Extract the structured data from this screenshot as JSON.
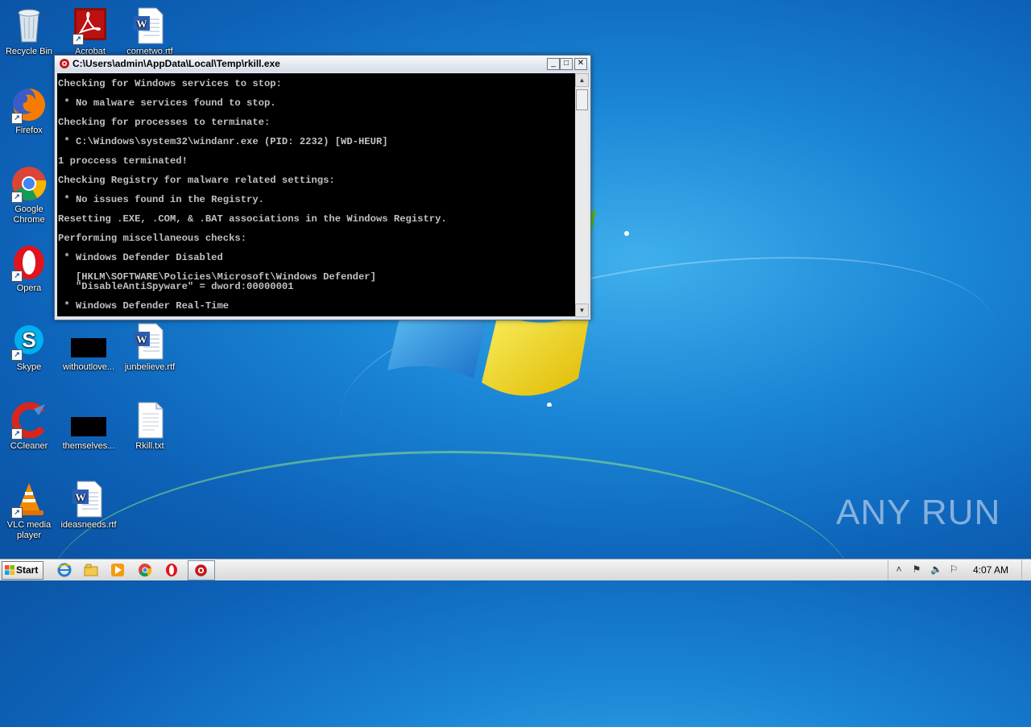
{
  "desktop": {
    "icons": [
      {
        "label": "Recycle Bin",
        "icon": "recycle-bin-icon"
      },
      {
        "label": "Acrobat",
        "icon": "acrobat-icon"
      },
      {
        "label": "cornetwo.rtf",
        "icon": "word-document-icon"
      },
      {
        "label": "Firefox",
        "icon": "firefox-icon"
      },
      {
        "label": "Google Chrome",
        "icon": "chrome-icon"
      },
      {
        "label": "Opera",
        "icon": "opera-icon"
      },
      {
        "label": "Skype",
        "icon": "skype-icon"
      },
      {
        "label": "withoutlove...",
        "icon": "black-thumbnail-icon"
      },
      {
        "label": "junbelieve.rtf",
        "icon": "word-document-icon"
      },
      {
        "label": "CCleaner",
        "icon": "ccleaner-icon"
      },
      {
        "label": "themselves...",
        "icon": "black-thumbnail-icon"
      },
      {
        "label": "Rkill.txt",
        "icon": "text-file-icon"
      },
      {
        "label": "VLC media player",
        "icon": "vlc-icon"
      },
      {
        "label": "ideasneeds.rtf",
        "icon": "word-document-icon"
      }
    ]
  },
  "window": {
    "title": "C:\\Users\\admin\\AppData\\Local\\Temp\\rkill.exe",
    "minimize": "_",
    "maximize": "□",
    "close": "✕"
  },
  "console": {
    "lines": [
      "Checking for Windows services to stop:",
      " * No malware services found to stop.",
      "Checking for processes to terminate:",
      " * C:\\Windows\\system32\\windanr.exe (PID: 2232) [WD-HEUR]",
      "1 proccess terminated!",
      "Checking Registry for malware related settings:",
      " * No issues found in the Registry.",
      "Resetting .EXE, .COM, & .BAT associations in the Windows Registry.",
      "Performing miscellaneous checks:",
      " * Windows Defender Disabled",
      "   [HKLM\\SOFTWARE\\Policies\\Microsoft\\Windows Defender]",
      "   \"DisableAntiSpyware\" = dword:00000001",
      " * Windows Defender Real-Time"
    ]
  },
  "taskbar": {
    "start_label": "Start",
    "clock": "4:07 AM",
    "pinned": [
      "ie-icon",
      "explorer-icon",
      "media-player-icon",
      "chrome-icon",
      "opera-icon",
      "rkill-icon"
    ]
  },
  "watermark": "ANY RUN",
  "colors": {
    "console_bg": "#000000",
    "console_text": "#c0c0c0",
    "desktop_blue": "#1a86d6"
  }
}
